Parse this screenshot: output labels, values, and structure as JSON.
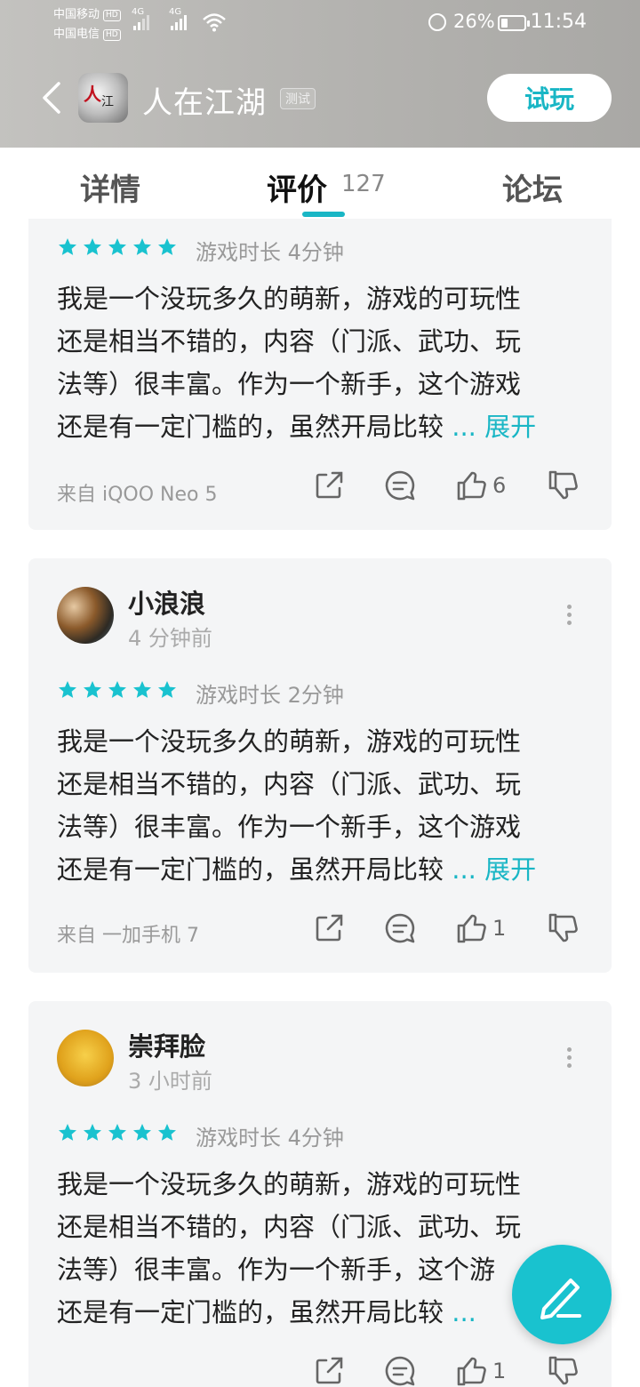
{
  "status": {
    "carrier1": "中国移动",
    "carrier2": "中国电信",
    "hd": "HD",
    "net1": "4G",
    "net2": "4G",
    "battery": "26%",
    "time": "11:54"
  },
  "app": {
    "title": "人在江湖",
    "badge": "测试",
    "try_label": "试玩"
  },
  "tabs": {
    "details": "详情",
    "reviews": "评价",
    "reviews_count": "127",
    "forum": "论坛"
  },
  "reviews": [
    {
      "playtime": "游戏时长 4分钟",
      "lines": [
        "我是一个没玩多久的萌新，游戏的可玩性",
        "还是相当不错的，内容（门派、武功、玩",
        "法等）很丰富。作为一个新手，这个游戏",
        "还是有一定门槛的，虽然开局比较"
      ],
      "ellipsis": "...",
      "expand": "展开",
      "device": "来自 iQOO Neo 5",
      "likes": "6",
      "rating": 5
    },
    {
      "username": "小浪浪",
      "time": "4 分钟前",
      "playtime": "游戏时长 2分钟",
      "lines": [
        "我是一个没玩多久的萌新，游戏的可玩性",
        "还是相当不错的，内容（门派、武功、玩",
        "法等）很丰富。作为一个新手，这个游戏",
        "还是有一定门槛的，虽然开局比较"
      ],
      "ellipsis": "...",
      "expand": "展开",
      "device": "来自 一加手机 7",
      "likes": "1",
      "rating": 5
    },
    {
      "username": "崇拜脸",
      "time": "3 小时前",
      "playtime": "游戏时长 4分钟",
      "lines": [
        "我是一个没玩多久的萌新，游戏的可玩性",
        "还是相当不错的，内容（门派、武功、玩",
        "法等）很丰富。作为一个新手，这个游",
        "还是有一定门槛的，虽然开局比较"
      ],
      "ellipsis": "...",
      "likes": "1",
      "rating": 5
    }
  ],
  "icons": {
    "share": "share-icon",
    "comment": "comment-icon",
    "like": "thumbs-up-icon",
    "dislike": "thumbs-down-icon",
    "star": "star-icon",
    "edit": "pencil-icon"
  },
  "colors": {
    "accent": "#19b6c5",
    "star": "#19c2cf",
    "card_bg": "#f4f5f6"
  }
}
